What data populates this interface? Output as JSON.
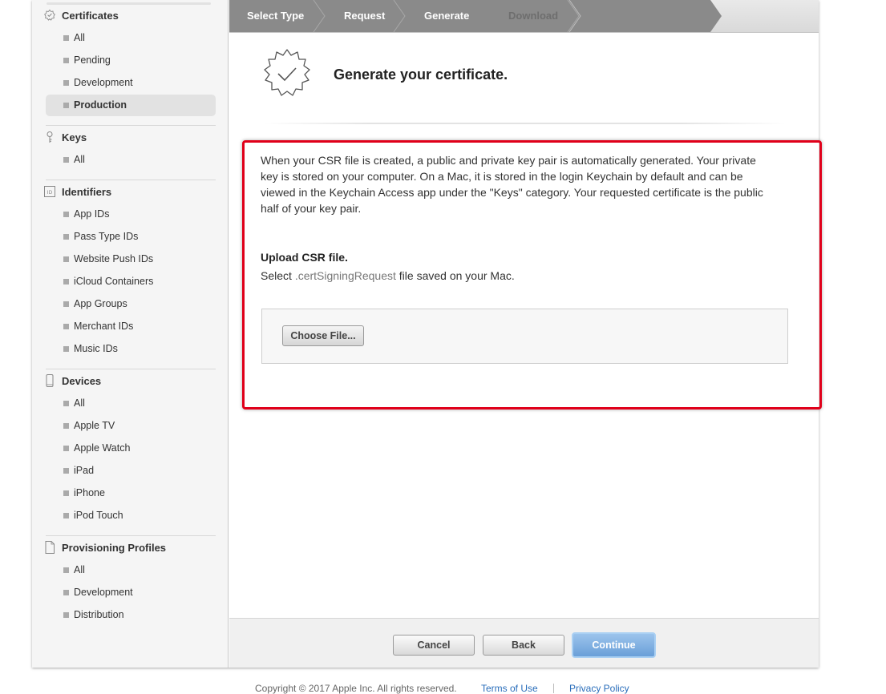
{
  "sidebar": {
    "sections": [
      {
        "title": "Certificates",
        "icon": "certificate-badge-icon",
        "items": [
          "All",
          "Pending",
          "Development",
          "Production"
        ],
        "selected": "Production"
      },
      {
        "title": "Keys",
        "icon": "key-icon",
        "items": [
          "All"
        ]
      },
      {
        "title": "Identifiers",
        "icon": "id-card-icon",
        "items": [
          "App IDs",
          "Pass Type IDs",
          "Website Push IDs",
          "iCloud Containers",
          "App Groups",
          "Merchant IDs",
          "Music IDs"
        ]
      },
      {
        "title": "Devices",
        "icon": "device-icon",
        "items": [
          "All",
          "Apple TV",
          "Apple Watch",
          "iPad",
          "iPhone",
          "iPod Touch"
        ]
      },
      {
        "title": "Provisioning Profiles",
        "icon": "document-icon",
        "items": [
          "All",
          "Development",
          "Distribution"
        ]
      }
    ]
  },
  "steps": {
    "items": [
      "Select Type",
      "Request",
      "Generate",
      "Download"
    ],
    "current": "Generate"
  },
  "header": {
    "title": "Generate your certificate.",
    "icon": "certificate-checkmark-icon"
  },
  "content": {
    "description": "When your CSR file is created, a public and private key pair is automatically generated. Your private key is stored on your computer. On a Mac, it is stored in the login Keychain by default and can be viewed in the Keychain Access app under the \"Keys\" category. Your requested certificate is the public half of your key pair.",
    "upload_title": "Upload CSR file.",
    "upload_prefix": "Select",
    "upload_ext": ".certSigningRequest",
    "upload_suffix": "file saved on your Mac.",
    "choose_file_label": "Choose File..."
  },
  "actions": {
    "cancel": "Cancel",
    "back": "Back",
    "continue": "Continue"
  },
  "footer": {
    "copyright": "Copyright © 2017 Apple Inc. All rights reserved.",
    "terms": "Terms of Use",
    "privacy": "Privacy Policy"
  },
  "colors": {
    "highlight": "#e0001a",
    "step_done": "#8a8a8a",
    "continue": "#7aaae0",
    "link": "#2a6ebb"
  }
}
